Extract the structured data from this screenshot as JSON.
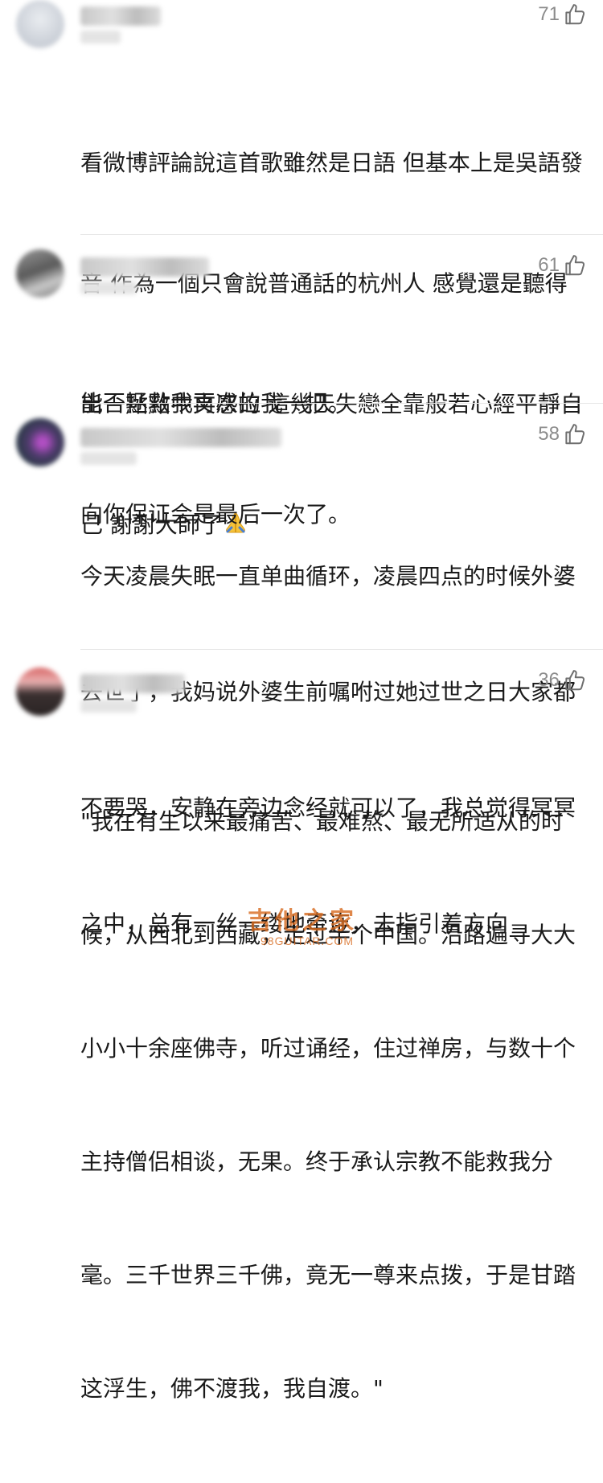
{
  "comments": [
    {
      "likes": "71",
      "lines": [
        "看微博評論說這首歌雖然是日語 但基本上是吳語發",
        "音 作為一個只會說普通話的杭州人 感覺還是聽得",
        "出一點點中文感的 這幾天失戀全靠般若心經平靜自",
        "己  謝謝大師了"
      ],
      "emoji": "folded-hands"
    },
    {
      "likes": "61",
      "lines": [
        "能否拯救我再次拉我一把。",
        "向你保证会是最后一次了。"
      ]
    },
    {
      "likes": "58",
      "lines": [
        "今天凌晨失眠一直单曲循环，凌晨四点的时候外婆",
        "去世了，我妈说外婆生前嘱咐过她过世之日大家都",
        "不要哭，安静在旁边念经就可以了，我总觉得冥冥",
        "之中，总有一丝一缕地牵连，去指引着方向"
      ]
    },
    {
      "likes": "36",
      "lines": [
        "\"我在有生以来最痛苦、最难熬、最无所适从的时",
        "候，从西北到西藏，走过半个中国。沿路遍寻大大",
        "小小十余座佛寺，听过诵经，住过禅房，与数十个",
        "主持僧侣相谈，无果。终于承认宗教不能救我分",
        "毫。三千世界三千佛，竟无一尊来点拨，于是甘踏",
        "这浮生，佛不渡我，我自渡。\""
      ]
    }
  ],
  "watermark": {
    "main": "吉他之家",
    "sub": "98GUITAR.COM"
  },
  "colors": {
    "text": "#1a1a1a",
    "meta": "#8c8c8c",
    "divider": "#e6e6e6",
    "watermark": "#d86a1e"
  },
  "icons": {
    "like": "thumbs-up-icon",
    "emoji": "folded-hands-icon"
  }
}
